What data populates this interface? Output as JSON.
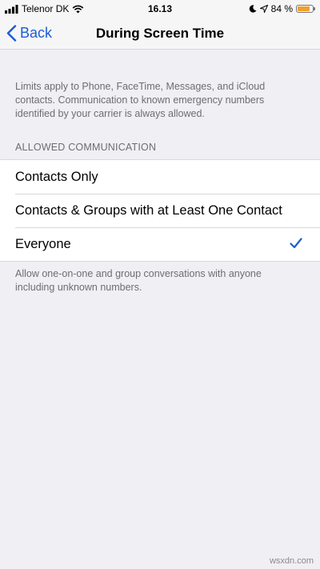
{
  "status_bar": {
    "carrier": "Telenor DK",
    "time": "16.13",
    "battery_percent": "84 %",
    "battery_level": 0.84,
    "icons": [
      "signal-bars-icon",
      "wifi-icon",
      "moon-icon",
      "location-icon",
      "battery-icon"
    ]
  },
  "nav": {
    "back_label": "Back",
    "title": "During Screen Time"
  },
  "description": "Limits apply to Phone, FaceTime, Messages, and iCloud contacts. Communication to known emergency numbers identified by your carrier is always allowed.",
  "section": {
    "header": "ALLOWED COMMUNICATION",
    "options": [
      {
        "label": "Contacts Only",
        "selected": false
      },
      {
        "label": "Contacts & Groups with at Least One Contact",
        "selected": false
      },
      {
        "label": "Everyone",
        "selected": true
      }
    ],
    "footer": "Allow one-on-one and group conversations with anyone including unknown numbers."
  },
  "watermark": "wsxdn.com",
  "colors": {
    "accent": "#1d5cd3",
    "background": "#efeff4",
    "secondary_text": "#6d6d72",
    "battery": "#f0a030"
  }
}
